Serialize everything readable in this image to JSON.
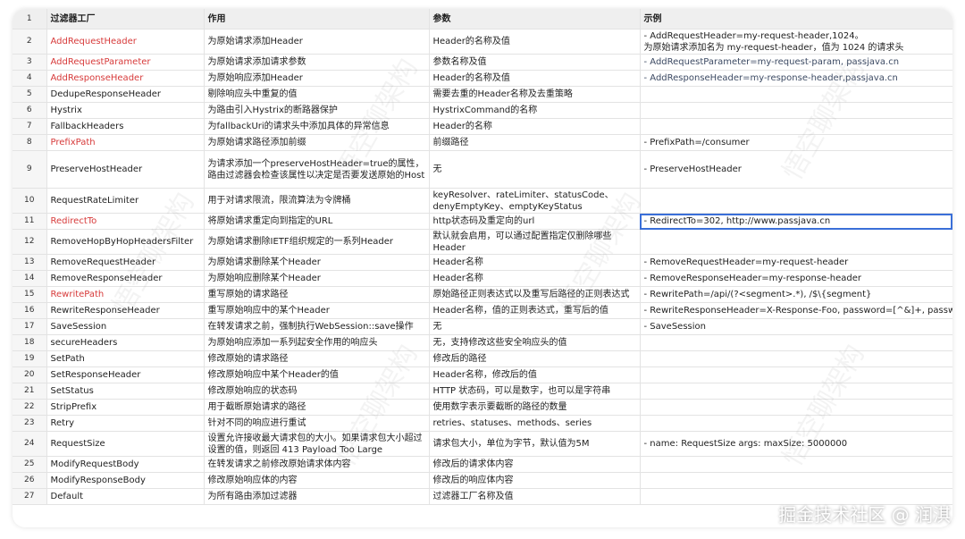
{
  "columns": {
    "index": "1",
    "name": "过滤器工厂",
    "use": "作用",
    "param": "参数",
    "example": "示例"
  },
  "rows": [
    {
      "n": "2",
      "name": "AddRequestHeader",
      "use": "为原始请求添加Header",
      "param": "Header的名称及值",
      "example": "- AddRequestHeader=my-request-header,1024。\n为原始请求添加名为 my-request-header，值为 1024 的请求头"
    },
    {
      "n": "3",
      "name": "AddRequestParameter",
      "use": "为原始请求添加请求参数",
      "param": "参数名称及值",
      "example": "- AddRequestParameter=my-request-param, passjava.cn"
    },
    {
      "n": "4",
      "name": "AddResponseHeader",
      "use": "为原始响应添加Header",
      "param": "Header的名称及值",
      "example": "- AddResponseHeader=my-response-header,passjava.cn"
    },
    {
      "n": "5",
      "name": "DedupeResponseHeader",
      "use": "剔除响应头中重复的值",
      "param": "需要去重的Header名称及去重策略",
      "example": ""
    },
    {
      "n": "6",
      "name": "Hystrix",
      "use": "为路由引入Hystrix的断路器保护",
      "param": "HystrixCommand的名称",
      "example": ""
    },
    {
      "n": "7",
      "name": "FallbackHeaders",
      "use": "为fallbackUri的请求头中添加具体的异常信息",
      "param": "Header的名称",
      "example": ""
    },
    {
      "n": "8",
      "name": "PrefixPath",
      "use": "为原始请求路径添加前缀",
      "param": "前缀路径",
      "example": "- PrefixPath=/consumer"
    },
    {
      "n": "9",
      "name": "PreserveHostHeader",
      "use": "为请求添加一个preserveHostHeader=true的属性，路由过滤器会检查该属性以决定是否要发送原始的Host",
      "param": "无",
      "example": "- PreserveHostHeader"
    },
    {
      "n": "10",
      "name": "RequestRateLimiter",
      "use": "用于对请求限流，限流算法为令牌桶",
      "param": "keyResolver、rateLimiter、statusCode、denyEmptyKey、emptyKeyStatus",
      "example": ""
    },
    {
      "n": "11",
      "name": "RedirectTo",
      "use": "将原始请求重定向到指定的URL",
      "param": "http状态码及重定向的url",
      "example": "- RedirectTo=302, http://www.passjava.cn"
    },
    {
      "n": "12",
      "name": "RemoveHopByHopHeadersFilter",
      "use": "为原始请求删除IETF组织规定的一系列Header",
      "param": "默认就会启用，可以通过配置指定仅删除哪些Header",
      "example": ""
    },
    {
      "n": "13",
      "name": "RemoveRequestHeader",
      "use": "为原始请求删除某个Header",
      "param": "Header名称",
      "example": "- RemoveRequestHeader=my-request-header"
    },
    {
      "n": "14",
      "name": "RemoveResponseHeader",
      "use": "为原始响应删除某个Header",
      "param": "Header名称",
      "example": "- RemoveResponseHeader=my-response-header"
    },
    {
      "n": "15",
      "name": "RewritePath",
      "use": "重写原始的请求路径",
      "param": "原始路径正则表达式以及重写后路径的正则表达式",
      "example": "- RewritePath=/api/(?<segment>.*), /$\\{segment}"
    },
    {
      "n": "16",
      "name": "RewriteResponseHeader",
      "use": "重写原始响应中的某个Header",
      "param": "Header名称，值的正则表达式，重写后的值",
      "example": "- RewriteResponseHeader=X-Response-Foo, password=[^&]+, password=***"
    },
    {
      "n": "17",
      "name": "SaveSession",
      "use": "在转发请求之前，强制执行WebSession::save操作",
      "param": "无",
      "example": "- SaveSession"
    },
    {
      "n": "18",
      "name": "secureHeaders",
      "use": "为原始响应添加一系列起安全作用的响应头",
      "param": "无，支持修改这些安全响应头的值",
      "example": ""
    },
    {
      "n": "19",
      "name": "SetPath",
      "use": "修改原始的请求路径",
      "param": "修改后的路径",
      "example": ""
    },
    {
      "n": "20",
      "name": "SetResponseHeader",
      "use": "修改原始响应中某个Header的值",
      "param": "Header名称，修改后的值",
      "example": ""
    },
    {
      "n": "21",
      "name": "SetStatus",
      "use": "修改原始响应的状态码",
      "param": "HTTP 状态码，可以是数字，也可以是字符串",
      "example": ""
    },
    {
      "n": "22",
      "name": "StripPrefix",
      "use": "用于截断原始请求的路径",
      "param": "使用数字表示要截断的路径的数量",
      "example": ""
    },
    {
      "n": "23",
      "name": "Retry",
      "use": "针对不同的响应进行重试",
      "param": "retries、statuses、methods、series",
      "example": ""
    },
    {
      "n": "24",
      "name": "RequestSize",
      "use": "设置允许接收最大请求包的大小。如果请求包大小超过设置的值，则返回 413 Payload Too Large",
      "param": "请求包大小，单位为字节，默认值为5M",
      "example": "- name: RequestSize args: maxSize: 5000000"
    },
    {
      "n": "25",
      "name": "ModifyRequestBody",
      "use": "在转发请求之前修改原始请求体内容",
      "param": "修改后的请求体内容",
      "example": ""
    },
    {
      "n": "26",
      "name": "ModifyResponseBody",
      "use": "修改原始响应体的内容",
      "param": "修改后的响应体内容",
      "example": ""
    },
    {
      "n": "27",
      "name": "Default",
      "use": "为所有路由添加过滤器",
      "param": "过滤器工厂名称及值",
      "example": ""
    }
  ],
  "colors": {
    "red_name": "#d73a3a",
    "selection": "#3a6fd8"
  },
  "watermark_text": "悟空聊架构",
  "brand_text": "掘金技术社区 @ 润淇"
}
